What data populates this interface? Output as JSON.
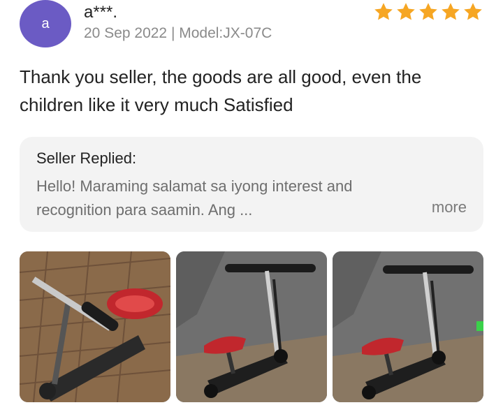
{
  "review": {
    "avatar_letter": "a",
    "username": "a***.",
    "meta": "20 Sep 2022 | Model:JX-07C",
    "rating": 5,
    "rating_max": 5,
    "star_color": "#f6a623",
    "text": "Thank you seller, the goods are all good, even the children like it very much Satisfied"
  },
  "seller_reply": {
    "title": "Seller Replied:",
    "text": "Hello! Maraming salamat sa iyong interest and recognition para saamin. Ang ...",
    "more_label": "more"
  },
  "photos": [
    {
      "icon": "scooter-photo-1"
    },
    {
      "icon": "scooter-photo-2"
    },
    {
      "icon": "scooter-photo-3"
    }
  ],
  "colors": {
    "avatar": "#6b5bc4",
    "reply_bg": "#f3f3f3"
  }
}
